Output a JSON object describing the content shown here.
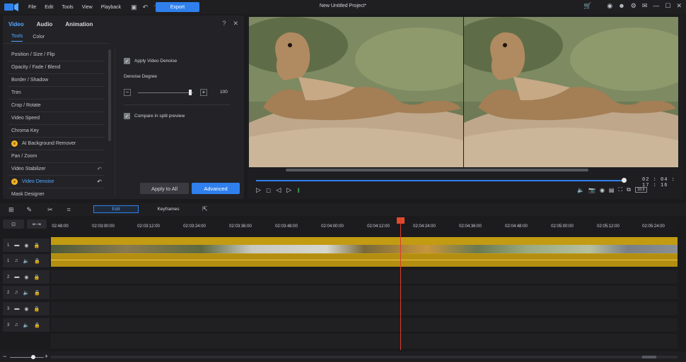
{
  "menubar": {
    "items": [
      "File",
      "Edit",
      "Tools",
      "View",
      "Playback"
    ],
    "export_label": "Export",
    "project_title": "New Untitled Project*"
  },
  "panel": {
    "tabs": [
      "Video",
      "Audio",
      "Animation"
    ],
    "subtabs": [
      "Tools",
      "Color"
    ],
    "tools": [
      "Position / Size / Flip",
      "Opacity / Fade / Blend",
      "Border / Shadow",
      "Trim",
      "Crop / Rotate",
      "Video Speed",
      "Chroma Key",
      "AI Background Remover",
      "Pan / Zoom",
      "Video Stabilizer",
      "Video Denoise",
      "Mask Designer"
    ],
    "apply_denoise_label": "Apply Video Denoise",
    "degree_label": "Denoise Degree",
    "degree_value": "100",
    "compare_label": "Compare in split preview",
    "apply_all_label": "Apply to All",
    "advanced_label": "Advanced",
    "minus": "−",
    "plus": "+"
  },
  "preview": {
    "timecode": "02 : 04 : 17 : 16",
    "progress": 0.96,
    "ratio": "16:9"
  },
  "timeline": {
    "edit_label": "Edit",
    "keyframes_label": "Keyframes",
    "ruler": [
      "02:48:00",
      "02:03:00:00",
      "02:03:12:00",
      "02:03:24:00",
      "02:03:36:00",
      "02:03:48:00",
      "02:04:00:00",
      "02:04:12:00",
      "02:04:24:00",
      "02:04:36:00",
      "02:04:48:00",
      "02:05:00:00",
      "02:05:12:00",
      "02:05:24:00"
    ],
    "tracks": [
      {
        "num": "1",
        "icon": "video-icon"
      },
      {
        "num": "1",
        "icon": "audio-icon"
      },
      {
        "num": "2",
        "icon": "video-icon"
      },
      {
        "num": "2",
        "icon": "audio-icon"
      },
      {
        "num": "3",
        "icon": "video-icon"
      },
      {
        "num": "3",
        "icon": "audio-icon"
      }
    ]
  },
  "colors": {
    "accent": "#2f80ed",
    "clip": "#c29b12",
    "playhead": "#e03a2d"
  }
}
